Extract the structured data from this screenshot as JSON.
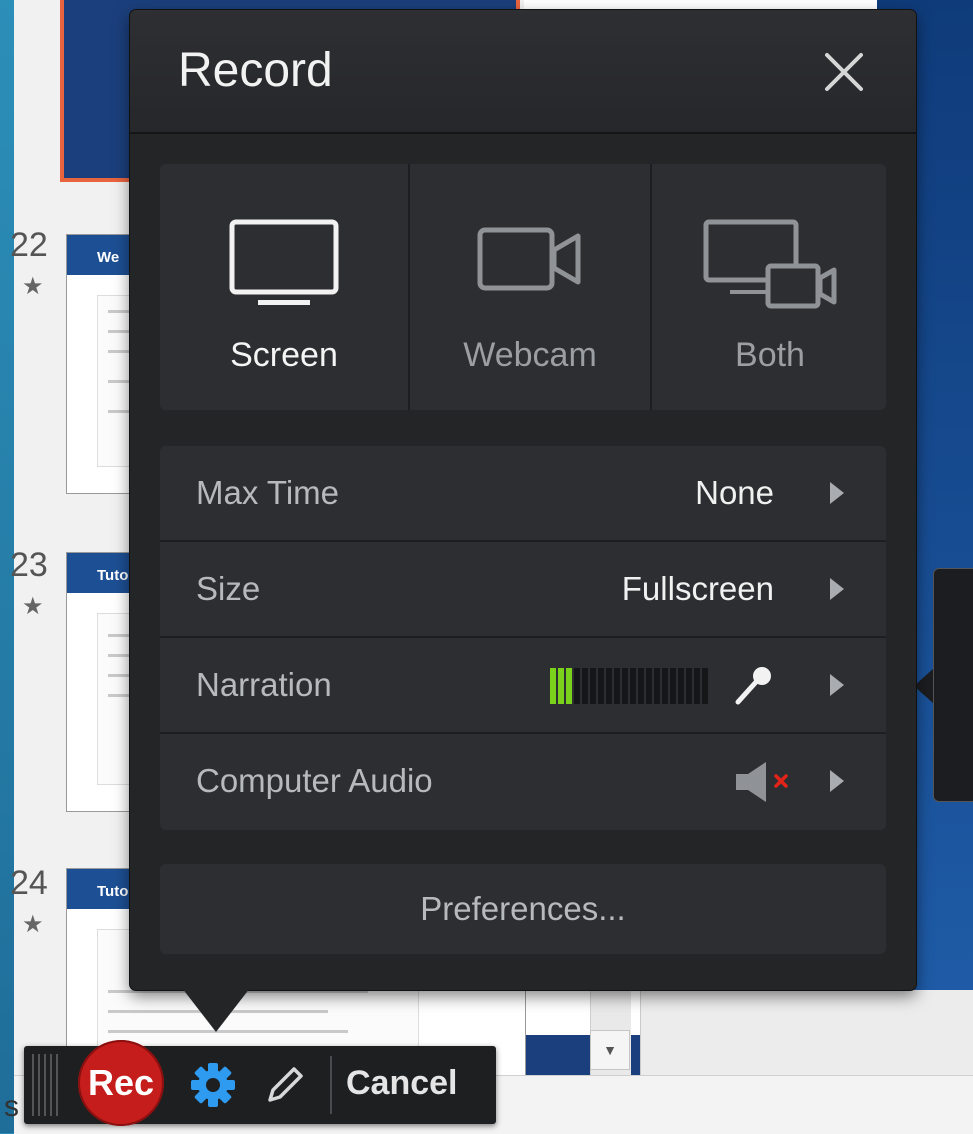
{
  "dialog": {
    "title": "Record",
    "close_icon": "close-icon"
  },
  "sources": [
    {
      "label": "Screen",
      "icon": "monitor-icon",
      "selected": true
    },
    {
      "label": "Webcam",
      "icon": "camera-icon",
      "selected": false
    },
    {
      "label": "Both",
      "icon": "monitor-camera-icon",
      "selected": false
    }
  ],
  "settings": {
    "max_time": {
      "label": "Max Time",
      "value": "None"
    },
    "size": {
      "label": "Size",
      "value": "Fullscreen"
    },
    "narration": {
      "label": "Narration",
      "level_segments_on": 3,
      "level_segments_total": 20,
      "icon": "microphone-icon"
    },
    "computer_audio": {
      "label": "Computer Audio",
      "icon": "speaker-muted-icon"
    }
  },
  "preferences_label": "Preferences...",
  "toolbar": {
    "rec_label": "Rec",
    "cancel_label": "Cancel",
    "gear_icon": "gear-icon",
    "pencil_icon": "pencil-icon"
  },
  "background": {
    "slides": [
      {
        "number": "22",
        "title": "We"
      },
      {
        "number": "23",
        "title": "Tuto"
      },
      {
        "number": "24",
        "title": "Tuto"
      }
    ],
    "status_char": "s"
  },
  "colors": {
    "accent_green": "#7bd21a",
    "rec_red": "#c51c1c",
    "gear_blue": "#2e9af0",
    "dialog_bg": "#242527",
    "slide_selection": "#e8643f"
  }
}
